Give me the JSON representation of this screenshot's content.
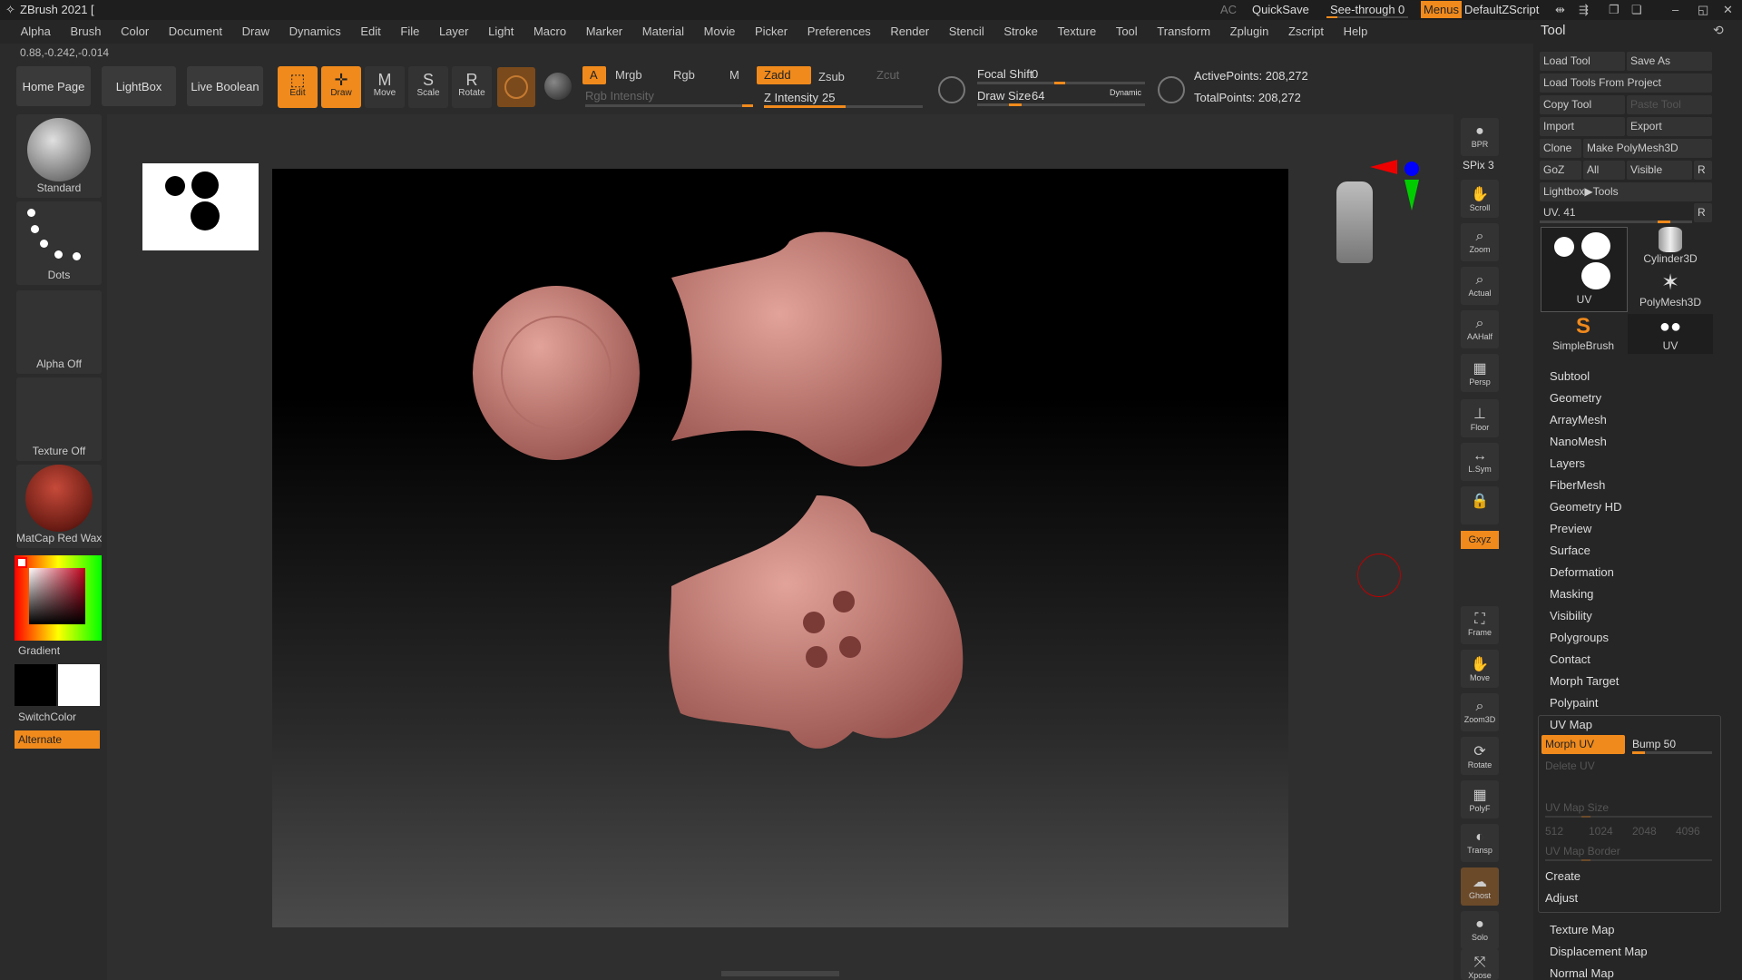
{
  "titlebar": {
    "app_title": "ZBrush 2021 [",
    "ac": "AC",
    "quicksave": "QuickSave",
    "see_through_label": "See-through",
    "see_through_value": "0",
    "menus": "Menus",
    "default_zscript": "DefaultZScript"
  },
  "menubar": [
    "Alpha",
    "Brush",
    "Color",
    "Document",
    "Draw",
    "Dynamics",
    "Edit",
    "File",
    "Layer",
    "Light",
    "Macro",
    "Marker",
    "Material",
    "Movie",
    "Picker",
    "Preferences",
    "Render",
    "Stencil",
    "Stroke",
    "Texture",
    "Tool",
    "Transform",
    "Zplugin",
    "Zscript",
    "Help"
  ],
  "coords": "0.88,-0.242,-0.014",
  "tabs": {
    "home": "Home Page",
    "lightbox": "LightBox",
    "live_boolean": "Live Boolean"
  },
  "tool_buttons": {
    "edit": "Edit",
    "draw": "Draw",
    "move": "Move",
    "scale": "Scale",
    "rotate": "Rotate"
  },
  "color_modes": {
    "a": "A",
    "mrgb": "Mrgb",
    "rgb": "Rgb",
    "m": "M",
    "zadd": "Zadd",
    "zsub": "Zsub",
    "zcut": "Zcut"
  },
  "sliders": {
    "rgb_intensity": "Rgb Intensity",
    "z_intensity_label": "Z Intensity",
    "z_intensity_value": "25",
    "focal_shift_label": "Focal Shift",
    "focal_shift_value": "0",
    "draw_size_label": "Draw Size",
    "draw_size_value": "64",
    "dynamic": "Dynamic"
  },
  "points": {
    "active": "ActivePoints: 208,272",
    "total": "TotalPoints: 208,272"
  },
  "left_shelf": {
    "brush": "Standard",
    "stroke": "Dots",
    "alpha": "Alpha Off",
    "texture": "Texture Off",
    "material": "MatCap Red Wax",
    "gradient": "Gradient",
    "switchcolor": "SwitchColor",
    "alternate": "Alternate"
  },
  "right_icons": [
    "BPR",
    "Scroll",
    "Zoom",
    "Actual",
    "AAHalf",
    "Persp",
    "Floor",
    "L.Sym",
    "",
    "Frame",
    "Move",
    "Zoom3D",
    "Rotate",
    "PolyF",
    "Transp",
    "Ghost",
    "Solo",
    "Xpose"
  ],
  "spix": "SPix 3",
  "xyz": "Gxyz",
  "tool_panel": {
    "title": "Tool",
    "load_tool": "Load Tool",
    "save_as": "Save As",
    "load_from_project": "Load Tools From Project",
    "copy_tool": "Copy Tool",
    "paste_tool": "Paste Tool",
    "import": "Import",
    "export": "Export",
    "clone": "Clone",
    "make_polymesh": "Make PolyMesh3D",
    "goz": "GoZ",
    "all": "All",
    "visible": "Visible",
    "r": "R",
    "lightbox_tools": "Lightbox▶Tools",
    "uv_slider": "UV. 41",
    "thumbs": [
      "UV",
      "Cylinder3D",
      "PolyMesh3D",
      "SimpleBrush",
      "UV"
    ],
    "sections": [
      "Subtool",
      "Geometry",
      "ArrayMesh",
      "NanoMesh",
      "Layers",
      "FiberMesh",
      "Geometry HD",
      "Preview",
      "Surface",
      "Deformation",
      "Masking",
      "Visibility",
      "Polygroups",
      "Contact",
      "Morph Target",
      "Polypaint",
      "UV Map"
    ],
    "morph_uv": "Morph UV",
    "bump": "Bump 50",
    "delete_uv": "Delete UV",
    "uv_map_size": "UV Map Size",
    "sizes": [
      "512",
      "1024",
      "2048",
      "4096"
    ],
    "uv_map_border": "UV Map Border",
    "create": "Create",
    "adjust": "Adjust",
    "tail_sections": [
      "Texture Map",
      "Displacement Map",
      "Normal Map"
    ]
  }
}
